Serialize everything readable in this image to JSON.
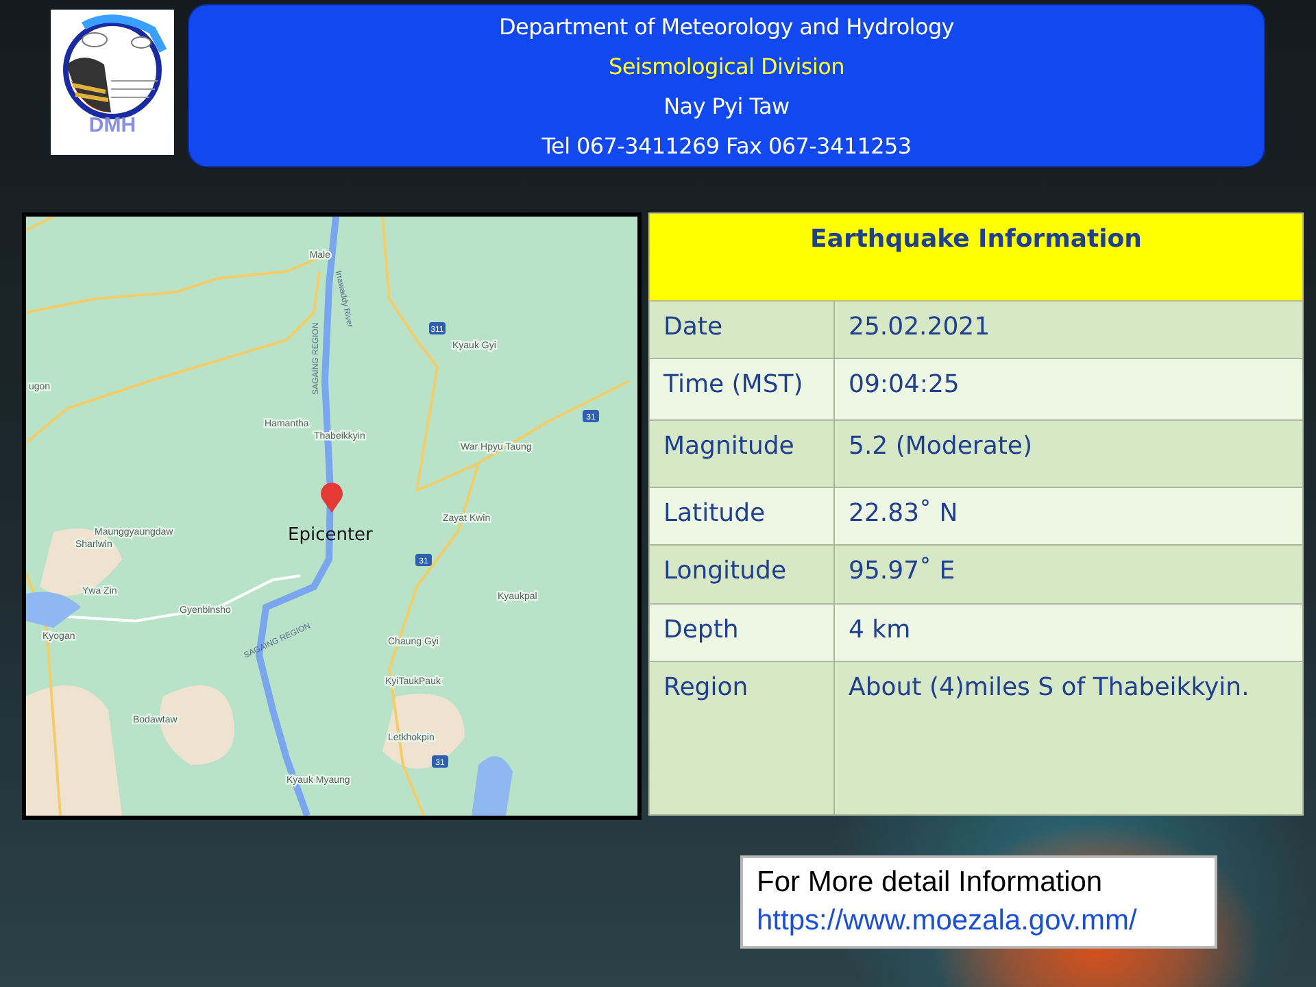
{
  "header": {
    "lines": [
      {
        "text": "Department of Meteorology and Hydrology",
        "highlight": false
      },
      {
        "text": "Seismological Division",
        "highlight": true
      },
      {
        "text": "Nay Pyi Taw",
        "highlight": false
      },
      {
        "text": "Tel 067-3411269 Fax 067-3411253",
        "highlight": false
      }
    ],
    "logo_text": "DMH"
  },
  "map": {
    "epicenter_label": "Epicenter",
    "places": [
      "Male",
      "Hamantha",
      "Thabeikkyin",
      "ugon",
      "Kyauk Gyi",
      "War Hpyu Taung",
      "Zayat Kwin",
      "Kyaukpal",
      "Chaung Gyi",
      "KyiTaukPauk",
      "Letkhokpin",
      "Kyauk Myaung",
      "Maunggyaungdaw",
      "Sharlwin",
      "Ywa Zin",
      "Gyenbinsho",
      "Kyogan",
      "Bodawtaw"
    ],
    "rotated_labels": [
      "Irrawaddy River",
      "SAGAING REGION",
      "SAGAING REGION"
    ],
    "road_markers": [
      "311",
      "31",
      "31",
      "31"
    ]
  },
  "info_table": {
    "title": "Earthquake Information",
    "rows": [
      {
        "label": "Date",
        "value": "25.02.2021"
      },
      {
        "label": "Time (MST)",
        "value": "09:04:25"
      },
      {
        "label": "Magnitude",
        "value": "5.2 (Moderate)"
      },
      {
        "label": "Latitude",
        "value": "22.83˚ N"
      },
      {
        "label": "Longitude",
        "value": "95.97˚ E"
      },
      {
        "label": "Depth",
        "value": "4 km"
      },
      {
        "label": "Region",
        "value": "About (4)miles S of Thabeikkyin."
      }
    ]
  },
  "more_info": {
    "text": "For More detail Information",
    "link": "https://www.moezala.gov.mm/"
  }
}
